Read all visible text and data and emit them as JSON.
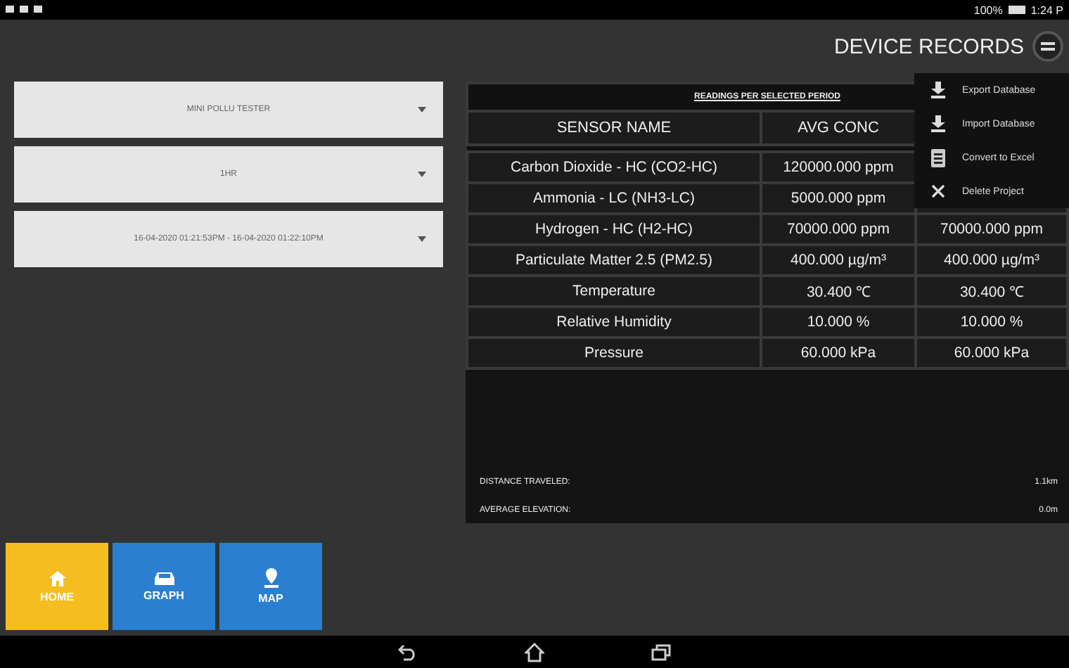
{
  "status_bar": {
    "battery": "100%",
    "time": "1:24 P"
  },
  "app_bar": {
    "title": "DEVICE RECORDS"
  },
  "menu": [
    {
      "label": "Export Database",
      "kind": "download"
    },
    {
      "label": "Import Database",
      "kind": "download"
    },
    {
      "label": "Convert to Excel",
      "kind": "sheet"
    },
    {
      "label": "Delete Project",
      "kind": "delete"
    }
  ],
  "dropdowns": [
    {
      "value": "MINI POLLU TESTER"
    },
    {
      "value": "1HR"
    },
    {
      "value": "16-04-2020 01:21:53PM - 16-04-2020 01:22:10PM"
    }
  ],
  "table": {
    "title": "READINGS PER SELECTED PERIOD",
    "columns": [
      "SENSOR NAME",
      "AVG CONC"
    ],
    "rows": [
      {
        "name": "Carbon Dioxide - HC (CO2-HC)",
        "avg": "120000.000 ppm"
      },
      {
        "name": "Ammonia - LC (NH3-LC)",
        "avg": "5000.000 ppm"
      },
      {
        "name": "Hydrogen - HC (H2-HC)",
        "avg": "70000.000 ppm",
        "column_3": "70000.000 ppm"
      },
      {
        "name": "Particulate Matter 2.5 (PM2.5)",
        "avg": "400.000 µg/m³",
        "column_3": "400.000 µg/m³"
      },
      {
        "name": "Temperature",
        "avg": "30.400 ℃",
        "column_3": "30.400 ℃"
      },
      {
        "name": "Relative Humidity",
        "avg": "10.000 %",
        "column_3": "10.000 %"
      },
      {
        "name": "Pressure",
        "avg": "60.000 kPa",
        "column_3": "60.000 kPa"
      }
    ]
  },
  "summary": [
    {
      "label": "DISTANCE TRAVELED:",
      "value": "1.1km"
    },
    {
      "label": "AVERAGE ELEVATION:",
      "value": "0.0m"
    }
  ],
  "nav": [
    {
      "label": "HOME",
      "kind": "home",
      "selected": true
    },
    {
      "label": "GRAPH",
      "kind": "graph",
      "selected": false
    },
    {
      "label": "MAP",
      "kind": "map",
      "selected": false
    }
  ]
}
